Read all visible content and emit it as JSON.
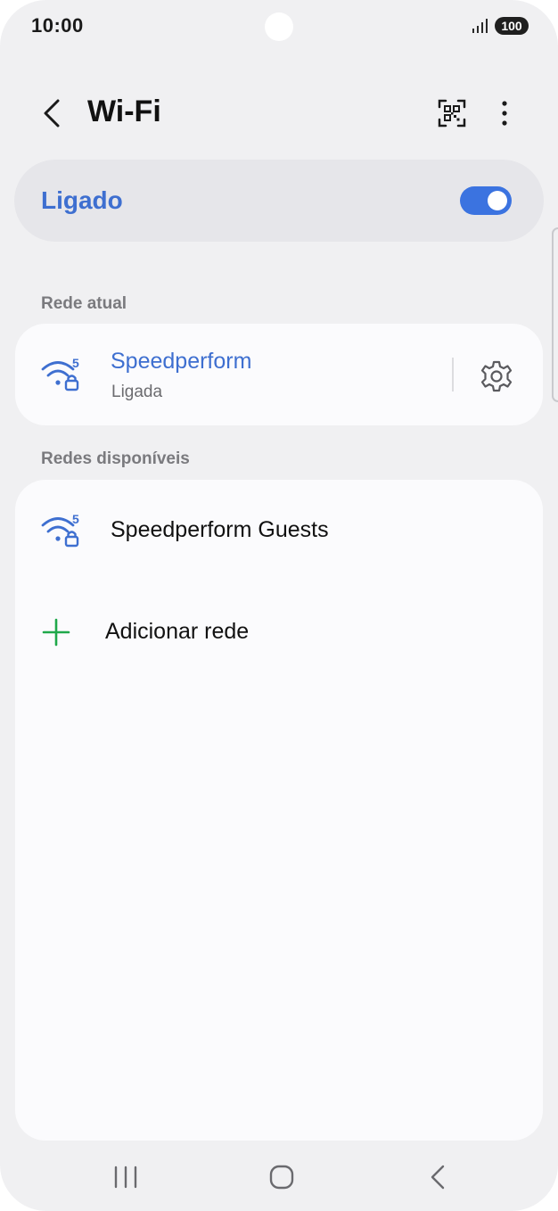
{
  "status_bar": {
    "time": "10:00",
    "battery": "100"
  },
  "header": {
    "title": "Wi-Fi"
  },
  "wifi_toggle": {
    "label": "Ligado",
    "on": true
  },
  "sections": {
    "current": "Rede atual",
    "available": "Redes disponíveis"
  },
  "current_network": {
    "name": "Speedperform",
    "status": "Ligada",
    "band": "5"
  },
  "available_networks": [
    {
      "name": "Speedperform Guests",
      "band": "5"
    }
  ],
  "add_network": {
    "label": "Adicionar rede"
  },
  "colors": {
    "accent": "#3e6fd0",
    "toggle": "#3b73e0",
    "add": "#1fa84a",
    "background": "#f0f0f2",
    "card": "#fbfbfd"
  }
}
